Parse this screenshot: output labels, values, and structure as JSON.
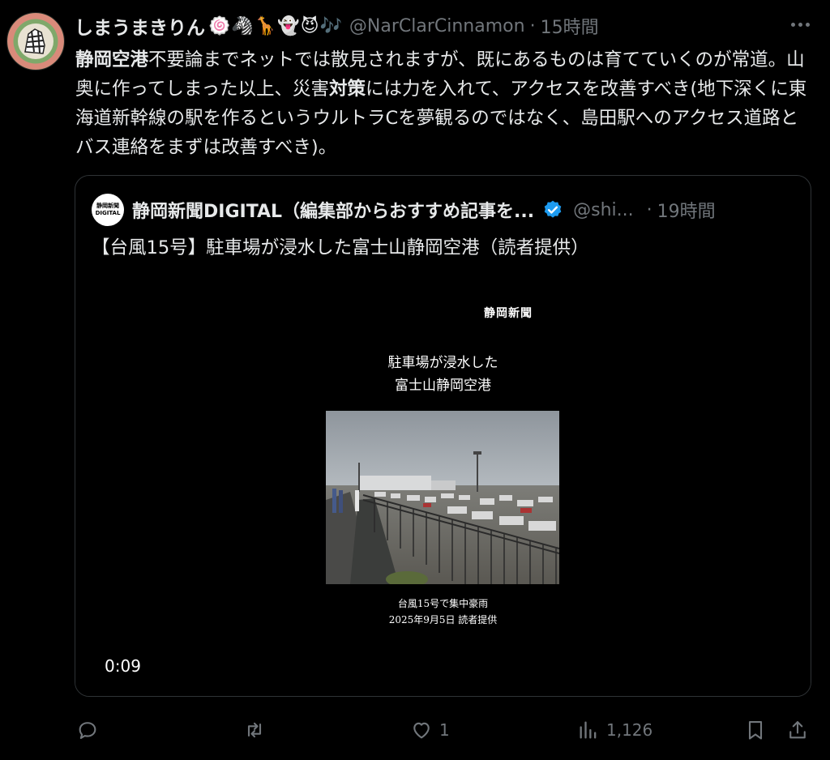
{
  "tweet": {
    "display_name": "しまうまきりん",
    "emojis": "🍥🦓🦒👻😈🎶",
    "handle": "@NarClarCinnamon",
    "separator": "·",
    "time": "15時間",
    "text_bold_1": "静岡空港",
    "text_part_1": "不要論までネットでは散見されますが、既にあるものは育てていくのが常道。山奥に作ってしまった以上、災害",
    "text_bold_2": "対策",
    "text_part_2": "には力を入れて、アクセスを改善すべき(地下深くに東海道新幹線の駅を作るというウルトラCを夢観るのではなく、島田駅へのアクセス道路とバス連絡をまずは改善すべき)。"
  },
  "quote": {
    "avatar_text_1": "静岡新聞",
    "avatar_text_2": "DIGITAL",
    "name": "静岡新聞DIGITAL（編集部からおすすめ記事を...",
    "handle": "@shi...",
    "separator": "·",
    "time": "19時間",
    "text": "【台風15号】駐車場が浸水した富士山静岡空港（読者提供）",
    "video": {
      "logo": "静岡新聞",
      "title_line_1": "駐車場が浸水した",
      "title_line_2": "富士山静岡空港",
      "caption_line_1": "台風15号で集中豪雨",
      "caption_line_2": "2025年9月5日 読者提供",
      "duration": "0:09"
    }
  },
  "actions": {
    "reply_icon": "reply-icon",
    "retweet_icon": "retweet-icon",
    "like_icon": "heart-icon",
    "like_count": "1",
    "views_icon": "views-icon",
    "views_count": "1,126",
    "bookmark_icon": "bookmark-icon",
    "share_icon": "share-icon"
  },
  "colors": {
    "background": "#000000",
    "text": "#e7e9ea",
    "muted": "#71767b",
    "border": "#2f3336",
    "verified": "#1d9bf0"
  }
}
